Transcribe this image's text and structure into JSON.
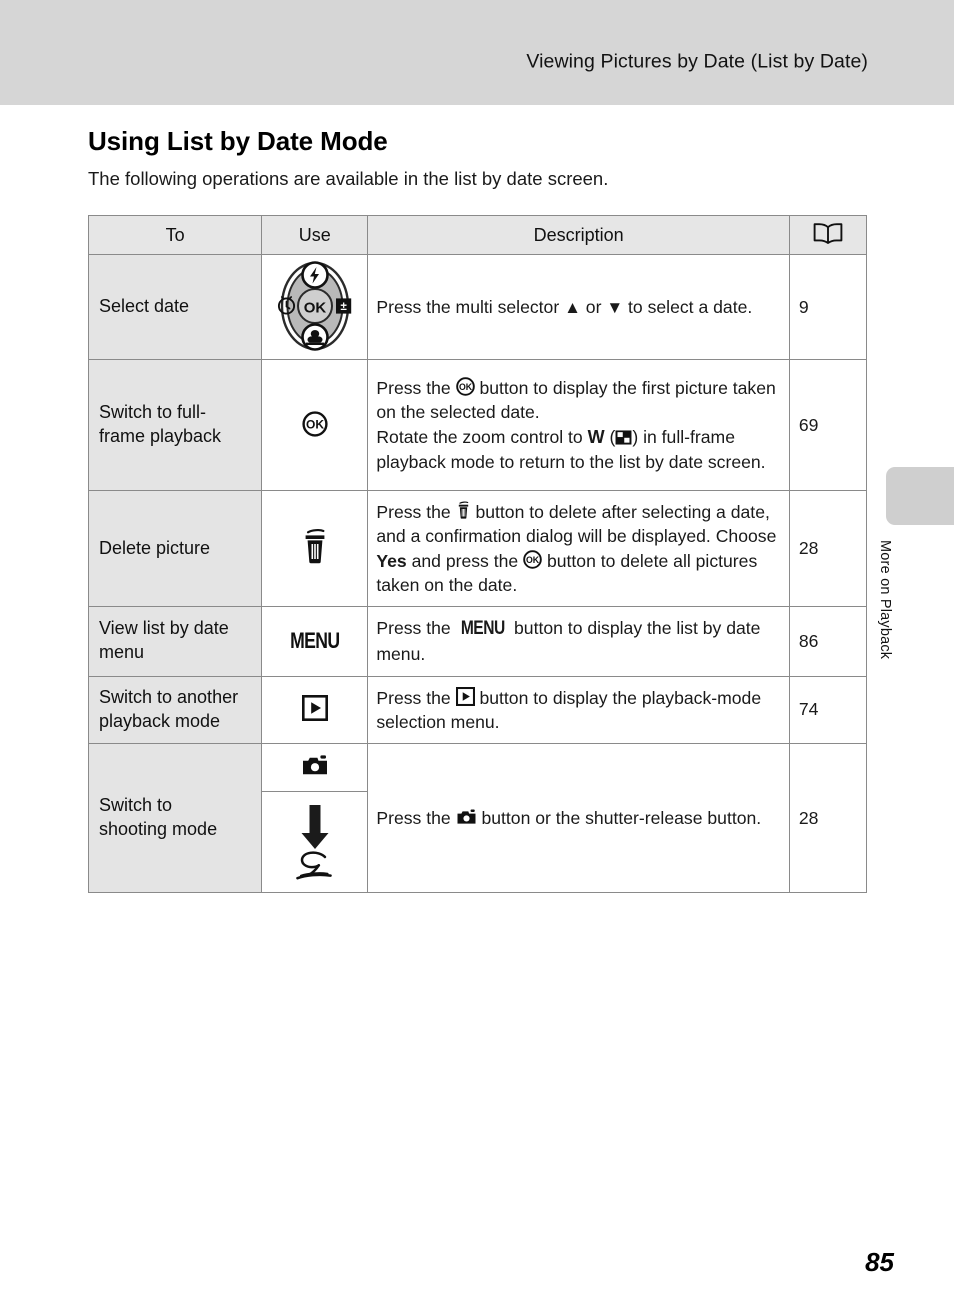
{
  "header": {
    "running_title": "Viewing Pictures by Date (List by Date)"
  },
  "side_tab": {
    "label": "More on Playback"
  },
  "page": {
    "title": "Using List by Date Mode",
    "intro": "The following operations are available in the list by date screen.",
    "folio": "85"
  },
  "table": {
    "headers": {
      "to": "To",
      "use": "Use",
      "description": "Description",
      "reference": "book-icon"
    },
    "rows": [
      {
        "to": "Select date",
        "use_icon": "multi-selector-dial-icon",
        "description_parts": [
          {
            "type": "text",
            "value": "Press the multi selector "
          },
          {
            "type": "glyph",
            "value": "up-triangle-icon"
          },
          {
            "type": "text",
            "value": " or "
          },
          {
            "type": "glyph",
            "value": "down-triangle-icon"
          },
          {
            "type": "text",
            "value": " to select a date."
          }
        ],
        "description_plain": "Press the multi selector ▲ or ▼ to select a date.",
        "reference": "9"
      },
      {
        "to": "Switch to full-frame playback",
        "use_icon": "ok-button-icon",
        "description_plain": "Press the OK button to display the first picture taken on the selected date. Rotate the zoom control to W (thumbnail) in full-frame playback mode to return to the list by date screen.",
        "reference": "69"
      },
      {
        "to": "Delete picture",
        "use_icon": "trash-icon",
        "description_plain": "Press the trash button to delete after selecting a date, and a confirmation dialog will be displayed. Choose Yes and press the OK button to delete all pictures taken on the date.",
        "emphasis": "Yes",
        "reference": "28"
      },
      {
        "to": "View list by date menu",
        "use_icon": "menu-button-icon",
        "use_label": "MENU",
        "description_plain": "Press the MENU button to display the list by date menu.",
        "reference": "86"
      },
      {
        "to": "Switch to another playback mode",
        "use_icon": "playback-button-icon",
        "description_plain": "Press the playback button to display the playback-mode selection menu.",
        "reference": "74"
      },
      {
        "to": "Switch to shooting mode",
        "use_icon": "camera-button-icon",
        "use_icon_secondary": "shutter-release-press-icon",
        "description_plain": "Press the camera button or the shutter-release button.",
        "reference": "28"
      }
    ]
  },
  "colors": {
    "header_band": "#d6d6d6",
    "tab": "#cfcfcf",
    "cell_label_bg": "#e4e4e4",
    "table_header_bg": "#e6e6e6",
    "rule": "#8a8a8a"
  }
}
